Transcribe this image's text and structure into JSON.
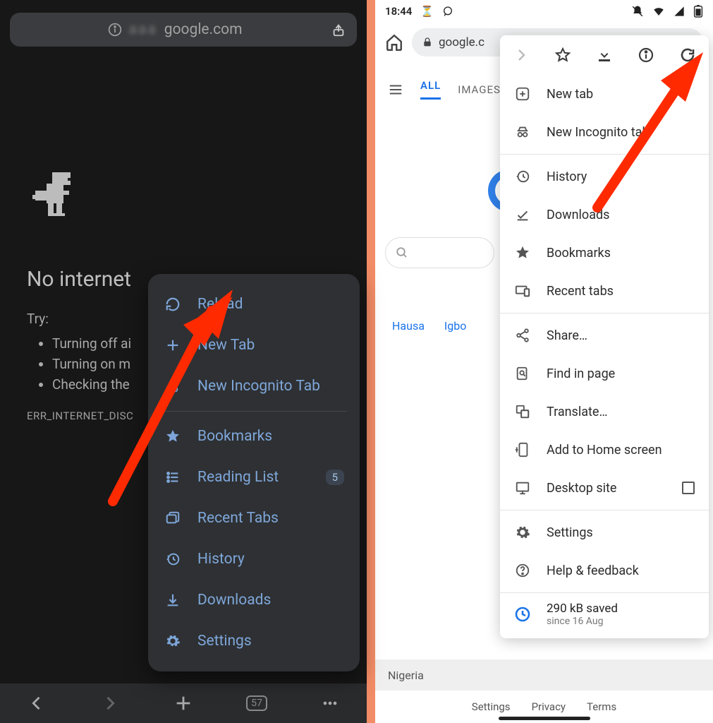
{
  "left": {
    "url_prefix": "",
    "url": "google.com",
    "title": "No internet",
    "try_heading": "Try:",
    "tips": [
      "Turning off ai",
      "Turning on m",
      "Checking the"
    ],
    "error_code": "ERR_INTERNET_DISC",
    "menu": {
      "reload": "Reload",
      "newtab": "New Tab",
      "incognito": "New Incognito Tab",
      "bookmarks": "Bookmarks",
      "reading": "Reading List",
      "reading_badge": "5",
      "recent": "Recent Tabs",
      "history": "History",
      "downloads": "Downloads",
      "settings": "Settings"
    },
    "tab_count": "57"
  },
  "right": {
    "status_time": "18:44",
    "url": "google.c",
    "tabs": {
      "all": "ALL",
      "images": "IMAGES"
    },
    "langs": [
      "Hausa",
      "Igbo"
    ],
    "country": "Nigeria",
    "footer_links": [
      "Settings",
      "Privacy",
      "Terms"
    ],
    "menu": {
      "newtab": "New tab",
      "incognito": "New Incognito tab",
      "history": "History",
      "downloads": "Downloads",
      "bookmarks": "Bookmarks",
      "recent": "Recent tabs",
      "share": "Share…",
      "find": "Find in page",
      "translate": "Translate…",
      "addhome": "Add to Home screen",
      "desktop": "Desktop site",
      "settings": "Settings",
      "help": "Help & feedback",
      "saved_amount": "290 kB saved",
      "saved_since": "since 16 Aug"
    }
  }
}
